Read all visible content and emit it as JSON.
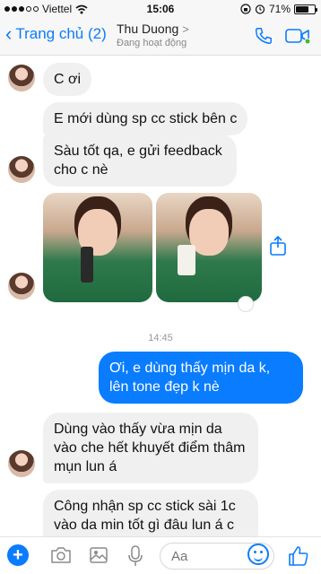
{
  "status_bar": {
    "carrier": "Viettel",
    "time": "15:06",
    "battery_percent": "71%",
    "battery_level": 0.71
  },
  "header": {
    "back_label": "Trang chủ (2)",
    "contact_name": "Thu Duong",
    "presence": "Đang hoạt động"
  },
  "messages": {
    "m1": "C ơi",
    "m2": "E mới dùng sp cc stick bên c",
    "m3": "Sàu tốt qa, e gửi feedback cho c nè",
    "timestamp": "14:45",
    "m4": "Ơi, e dùng thấy mịn da k, lên tone đẹp k nè",
    "m5": "Dùng vào thấy vừa mịn da vào che hết khuyết điểm thâm mụn lun á",
    "m6": "Công nhận sp cc stick sài 1c vào da min tốt gì đâu lun á c"
  },
  "composer": {
    "placeholder": "Aa"
  },
  "icons": [
    "signal-dots-icon",
    "wifi-icon",
    "lock-rotation-icon",
    "alarm-icon",
    "battery-icon",
    "back-chevron-icon",
    "phone-icon",
    "video-icon",
    "share-icon",
    "plus-icon",
    "camera-icon",
    "image-icon",
    "microphone-icon",
    "emoji-icon",
    "thumbs-up-icon"
  ],
  "colors": {
    "accent": "#0a7cff",
    "incoming_bubble": "#f1f0f0",
    "online": "#42b72a"
  }
}
